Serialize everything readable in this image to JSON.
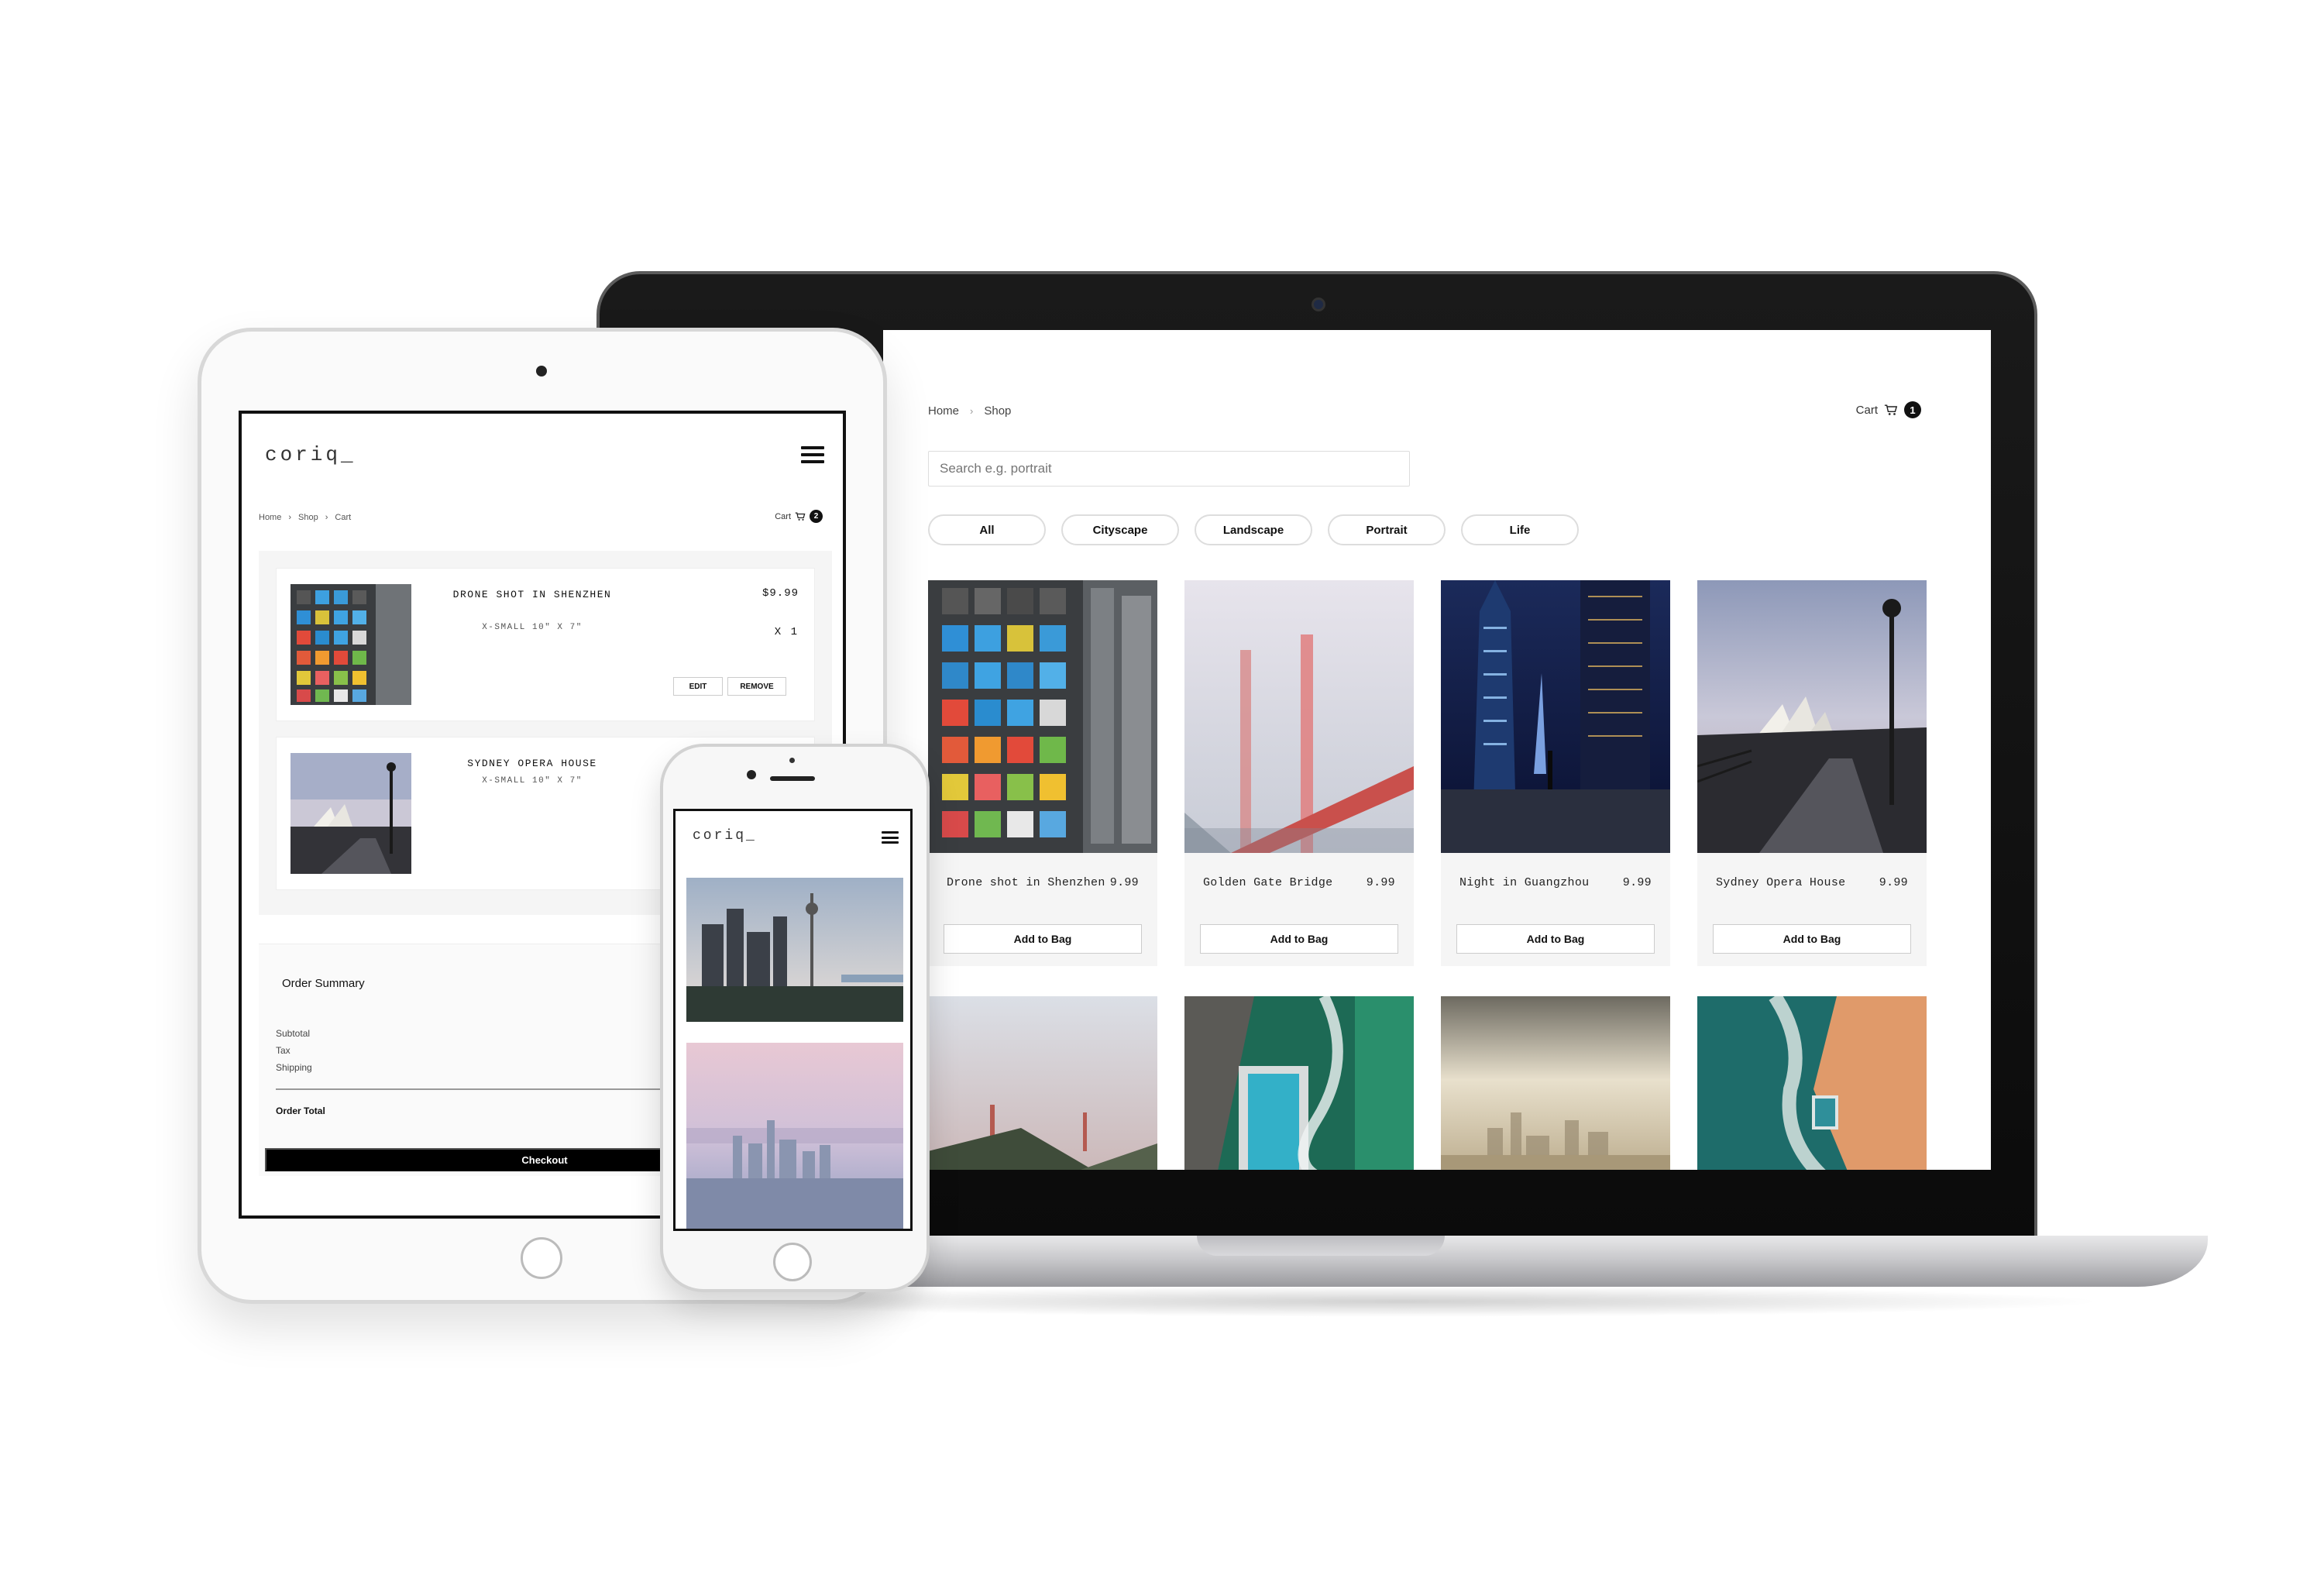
{
  "desktop": {
    "breadcrumb": [
      "Home",
      "Shop"
    ],
    "cart_label": "Cart",
    "cart_count": "1",
    "search_placeholder": "Search e.g. portrait",
    "filters": [
      "All",
      "Cityscape",
      "Landscape",
      "Portrait",
      "Life"
    ],
    "products": [
      {
        "name": "Drone shot in Shenzhen",
        "price": "9.99",
        "button": "Add to Bag"
      },
      {
        "name": "Golden Gate Bridge",
        "price": "9.99",
        "button": "Add to Bag"
      },
      {
        "name": "Night in Guangzhou",
        "price": "9.99",
        "button": "Add to Bag"
      },
      {
        "name": "Sydney Opera House",
        "price": "9.99",
        "button": "Add to Bag"
      }
    ]
  },
  "tablet": {
    "logo": "coriq_",
    "breadcrumb": [
      "Home",
      "Shop",
      "Cart"
    ],
    "cart_label": "Cart",
    "cart_count": "2",
    "items": [
      {
        "title": "DRONE SHOT IN SHENZHEN",
        "size": "X-SMALL 10\" X 7\"",
        "price": "$9.99",
        "qty": "X 1",
        "edit": "EDIT",
        "remove": "REMOVE"
      },
      {
        "title": "SYDNEY OPERA HOUSE",
        "size": "X-SMALL 10\" X 7\""
      }
    ],
    "summary": {
      "heading": "Order Summary",
      "subtotal": "Subtotal",
      "tax": "Tax",
      "shipping": "Shipping",
      "total": "Order Total",
      "checkout": "Checkout"
    }
  },
  "phone": {
    "logo": "coriq_"
  },
  "colors": {
    "accent": "#111111",
    "card_bg": "#f5f5f5",
    "border": "#dddddd"
  }
}
